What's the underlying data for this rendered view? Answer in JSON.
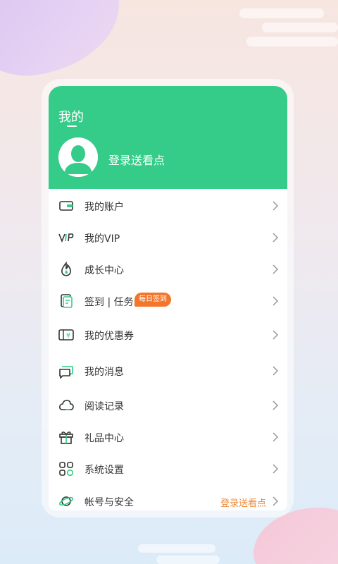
{
  "header": {
    "title": "我的",
    "login_prompt": "登录送看点"
  },
  "menu": [
    {
      "label": "我的账户",
      "icon": "wallet-icon"
    },
    {
      "label": "我的VIP",
      "icon": "vip-icon"
    },
    {
      "label": "成长中心",
      "icon": "flame-icon"
    },
    {
      "label": "签到 | 任务",
      "icon": "checkin-icon",
      "badge": "每日签到"
    },
    {
      "label": "我的优惠券",
      "icon": "coupon-icon"
    },
    {
      "label": "我的消息",
      "icon": "message-icon"
    },
    {
      "label": "阅读记录",
      "icon": "cloud-icon"
    },
    {
      "label": "礼品中心",
      "icon": "gift-icon"
    },
    {
      "label": "系统设置",
      "icon": "settings-grid-icon"
    },
    {
      "label": "帐号与安全",
      "icon": "planet-icon",
      "right_text": "登录送看点"
    }
  ],
  "colors": {
    "accent_green": "#34cc88",
    "badge_orange": "#f3762a",
    "link_orange": "#ef8a3b"
  }
}
